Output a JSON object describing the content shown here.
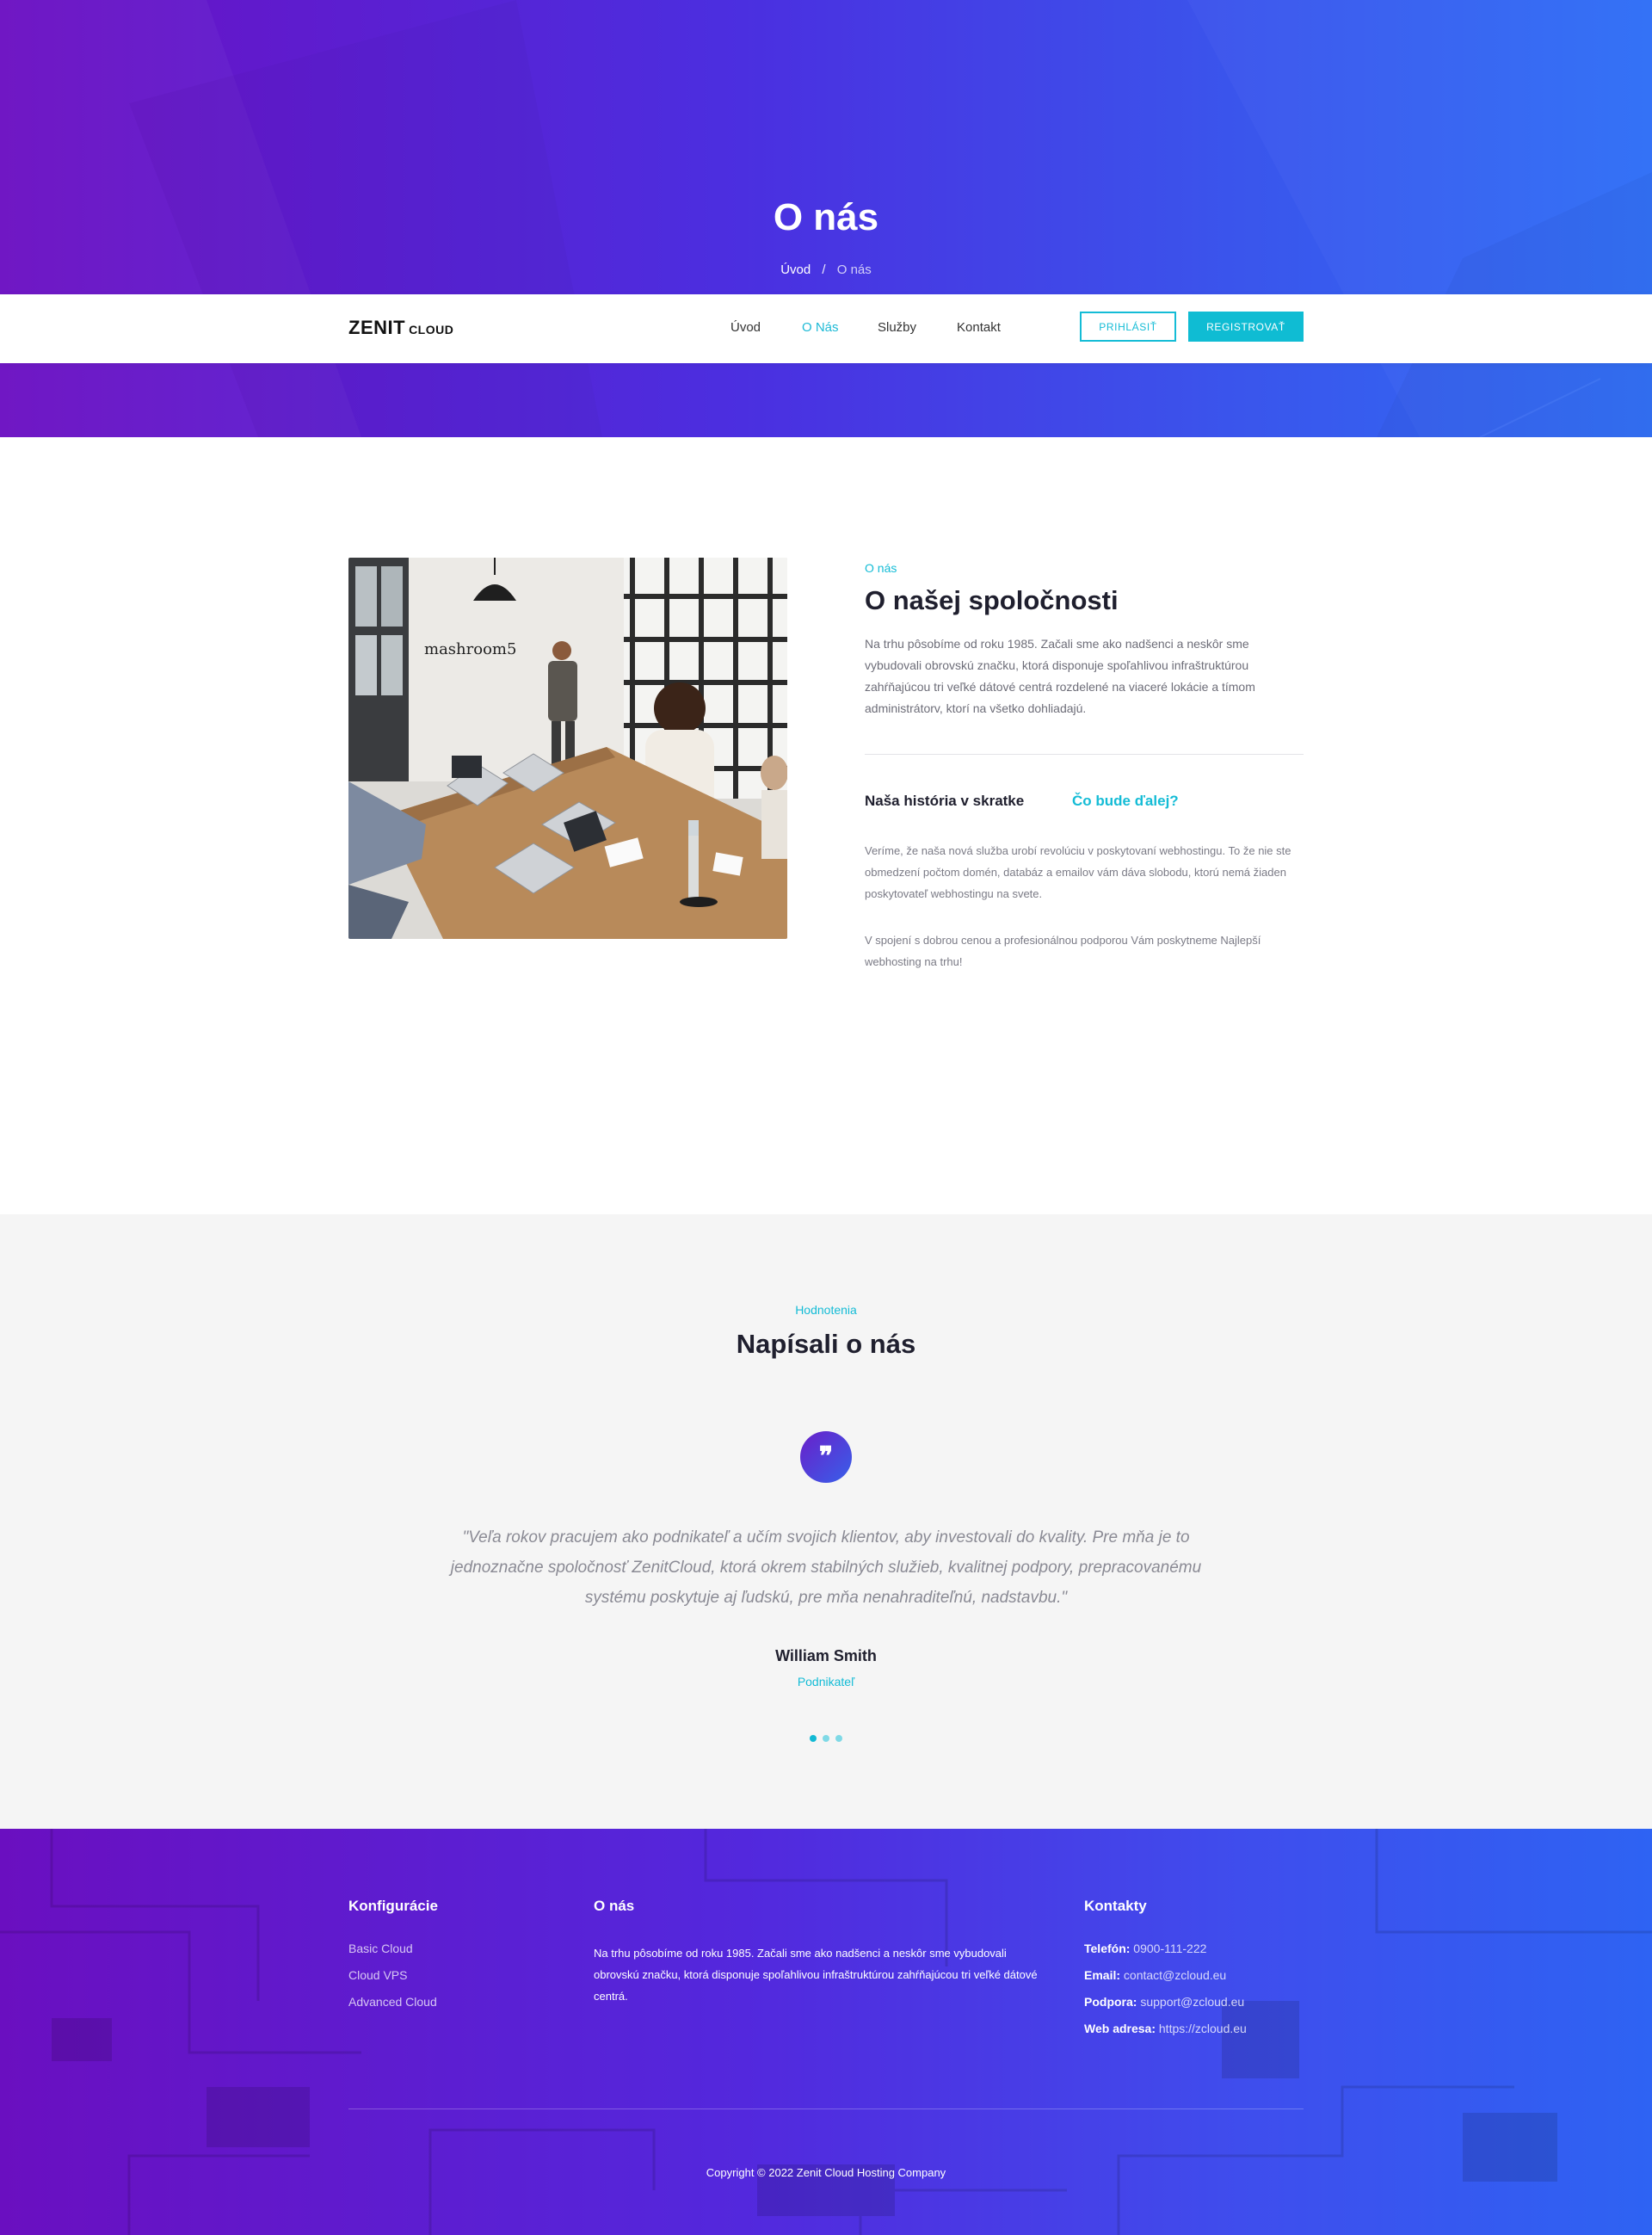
{
  "hero": {
    "title": "O nás",
    "breadcrumb": {
      "home": "Úvod",
      "separator": "/",
      "current": "O nás"
    }
  },
  "navbar": {
    "logo": {
      "brand": "ZENIT",
      "suffix": "CLOUD"
    },
    "items": [
      {
        "label": "Úvod",
        "active": false
      },
      {
        "label": "O Nás",
        "active": true
      },
      {
        "label": "Služby",
        "active": false
      },
      {
        "label": "Kontakt",
        "active": false
      }
    ],
    "login_label": "PRIHLÁSIŤ",
    "register_label": "REGISTROVAŤ"
  },
  "about": {
    "eyebrow": "O nás",
    "title": "O našej spoločnosti",
    "text": "Na trhu pôsobíme od roku 1985. Začali sme ako nadšenci a neskôr sme vybudovali obrovskú značku, ktorá disponuje spoľahlivou infraštruktúrou zahŕňajúcou tri veľké dátové centrá rozdelené na viaceré lokácie a tímom administrátorv, ktorí na všetko dohliadajú.",
    "photo_sign": "mashroom5",
    "tabs": [
      {
        "label": "Naša história v skratke",
        "active": false
      },
      {
        "label": "Čo bude ďalej?",
        "active": true
      }
    ],
    "paragraphs": [
      "Veríme, že naša nová služba urobí revolúciu v poskytovaní webhostingu. To že nie ste obmedzení počtom domén, databáz a emailov vám dáva slobodu, ktorú nemá žiaden poskytovateľ webhostingu na svete.",
      "V spojení s dobrou cenou a profesionálnou podporou Vám poskytneme Najlepší webhosting na trhu!"
    ]
  },
  "testimonials": {
    "eyebrow": "Hodnotenia",
    "title": "Napísali o nás",
    "quote_glyph": "❞",
    "quote": "\"Veľa rokov pracujem ako podnikateľ a učím svojich klientov, aby investovali do kvality. Pre mňa je to jednoznačne spoločnosť ZenitCloud, ktorá okrem stabilných služieb, kvalitnej podpory, prepracovanému systému poskytuje aj ľudskú, pre mňa nenahraditeľnú, nadstavbu.\"",
    "author": "William Smith",
    "role": "Podnikateľ",
    "slides": 3,
    "active_slide": 1
  },
  "footer": {
    "config": {
      "heading": "Konfigurácie",
      "links": [
        "Basic Cloud",
        "Cloud VPS",
        "Advanced Cloud"
      ]
    },
    "about": {
      "heading": "O nás",
      "text": "Na trhu pôsobíme od roku 1985. Začali sme ako nadšenci a neskôr sme vybudovali obrovskú značku, ktorá disponuje spoľahlivou infraštruktúrou zahŕňajúcou tri veľké dátové centrá."
    },
    "contacts": {
      "heading": "Kontakty",
      "items": [
        {
          "label": "Telefón:",
          "value": "0900-111-222"
        },
        {
          "label": "Email:",
          "value": "contact@zcloud.eu"
        },
        {
          "label": "Podpora:",
          "value": "support@zcloud.eu"
        },
        {
          "label": "Web adresa:",
          "value": "https://zcloud.eu"
        }
      ]
    },
    "copyright": "Copyright © 2022 Zenit Cloud Hosting Company"
  },
  "colors": {
    "accent": "#14bcd6",
    "hero_gradient_start": "#6b0fc2",
    "hero_gradient_end": "#2f6ef5",
    "heading": "#1f1f2e",
    "testimonial_bg": "#f5f5f5"
  }
}
